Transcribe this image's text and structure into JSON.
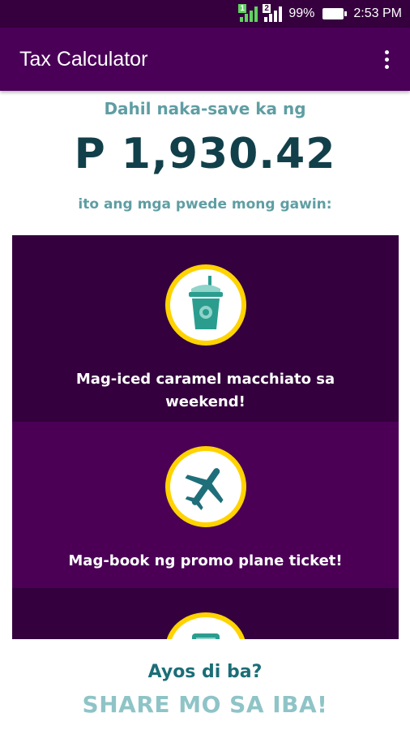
{
  "status_bar": {
    "sim1": "1",
    "sim2": "2",
    "battery": "99%",
    "time": "2:53 PM"
  },
  "app_bar": {
    "title": "Tax Calculator"
  },
  "summary": {
    "save_label": "Dahil naka-save ka ng",
    "amount": "P 1,930.42",
    "options_label": "ito ang mga pwede mong gawin:"
  },
  "options": [
    {
      "icon": "iced-drink-icon",
      "label": "Mag-iced caramel macchiato sa weekend!"
    },
    {
      "icon": "airplane-icon",
      "label": "Mag-book ng promo plane ticket!"
    },
    {
      "icon": "item-icon",
      "label": ""
    }
  ],
  "footer": {
    "question": "Ayos di ba?",
    "share": "SHARE MO SA IBA!"
  },
  "colors": {
    "app_bar": "#4a0057",
    "card_dark": "#34003d",
    "card_light": "#4b0056",
    "accent_yellow": "#ffd300",
    "teal": "#1b6e77"
  }
}
